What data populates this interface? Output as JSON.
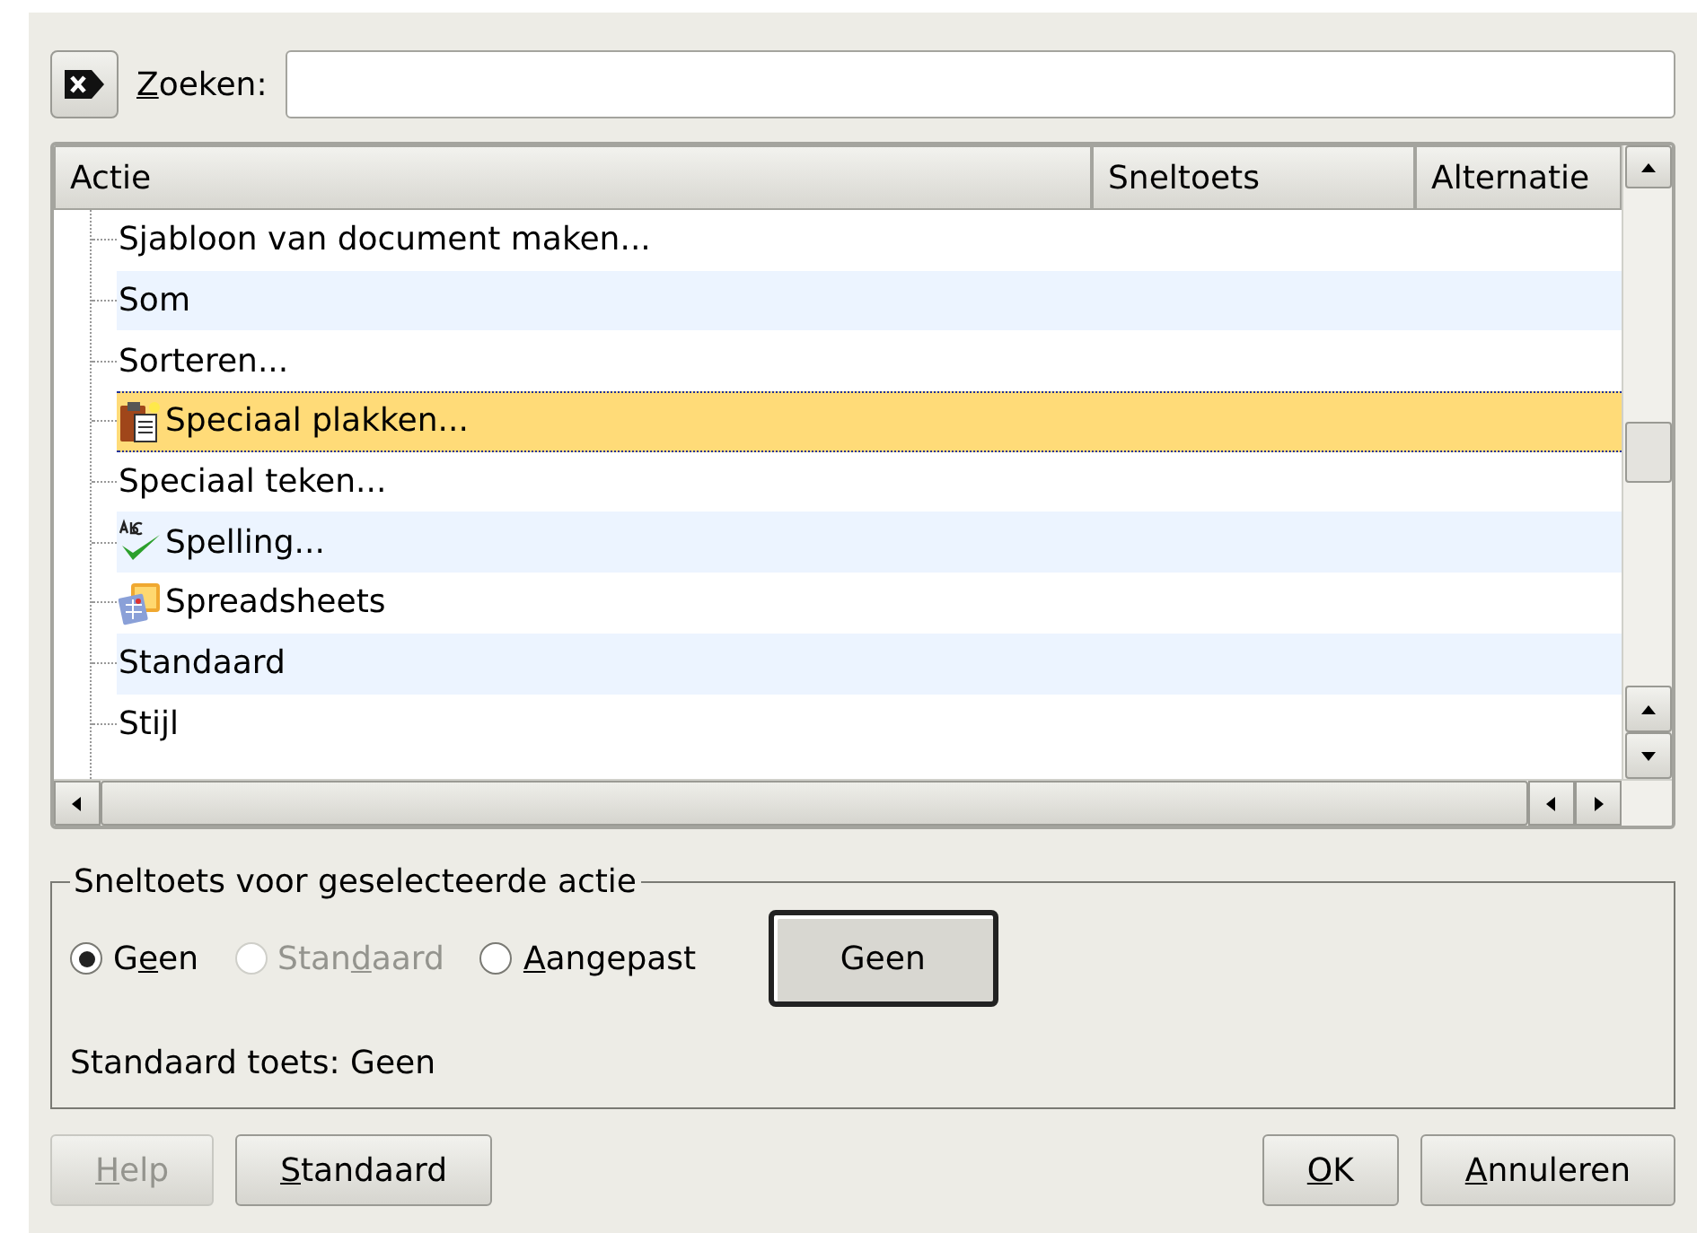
{
  "search": {
    "label": [
      {
        "text": "Z",
        "underlined": true
      },
      {
        "text": "oeken:",
        "underlined": false
      }
    ]
  },
  "table": {
    "columns": [
      "Actie",
      "Sneltoets",
      "Alternatie"
    ],
    "rows": [
      {
        "label": "Sjabloon van document maken...",
        "kind": "text",
        "selected": false
      },
      {
        "label": "Som",
        "kind": "text",
        "selected": false
      },
      {
        "label": "Sorteren...",
        "kind": "text",
        "selected": false
      },
      {
        "label": "Speciaal plakken...",
        "kind": "paste",
        "selected": true
      },
      {
        "label": "Speciaal teken...",
        "kind": "text",
        "selected": false
      },
      {
        "label": "Spelling...",
        "kind": "spelling",
        "selected": false
      },
      {
        "label": "Spreadsheets",
        "kind": "spreadsheet",
        "selected": false
      },
      {
        "label": "Standaard",
        "kind": "text",
        "selected": false
      },
      {
        "label": "Stijl",
        "kind": "text",
        "selected": false
      }
    ]
  },
  "shortcut_group": {
    "title": "Sneltoets voor geselecteerde actie",
    "options": [
      {
        "label": [
          {
            "text": "G",
            "underlined": false
          },
          {
            "text": "e",
            "underlined": true
          },
          {
            "text": "en",
            "underlined": false
          }
        ],
        "selected": true,
        "disabled": false
      },
      {
        "label": [
          {
            "text": "Stan",
            "underlined": false
          },
          {
            "text": "d",
            "underlined": true
          },
          {
            "text": "aard",
            "underlined": false
          }
        ],
        "selected": false,
        "disabled": true
      },
      {
        "label": [
          {
            "text": "A",
            "underlined": true
          },
          {
            "text": "angepast",
            "underlined": false
          }
        ],
        "selected": false,
        "disabled": false
      }
    ],
    "key_button": "Geen",
    "default_key": "Standaard toets: Geen"
  },
  "buttons_left": [
    {
      "label": [
        {
          "text": "H",
          "underlined": true
        },
        {
          "text": "elp",
          "underlined": false
        }
      ],
      "disabled": true
    },
    {
      "label": [
        {
          "text": "S",
          "underlined": true
        },
        {
          "text": "tandaard",
          "underlined": false
        }
      ],
      "disabled": false
    }
  ],
  "buttons_right": [
    {
      "label": [
        {
          "text": "O",
          "underlined": true
        },
        {
          "text": "K",
          "underlined": false
        }
      ],
      "disabled": false
    },
    {
      "label": [
        {
          "text": "A",
          "underlined": true
        },
        {
          "text": "nnuleren",
          "underlined": false
        }
      ],
      "disabled": false
    }
  ]
}
